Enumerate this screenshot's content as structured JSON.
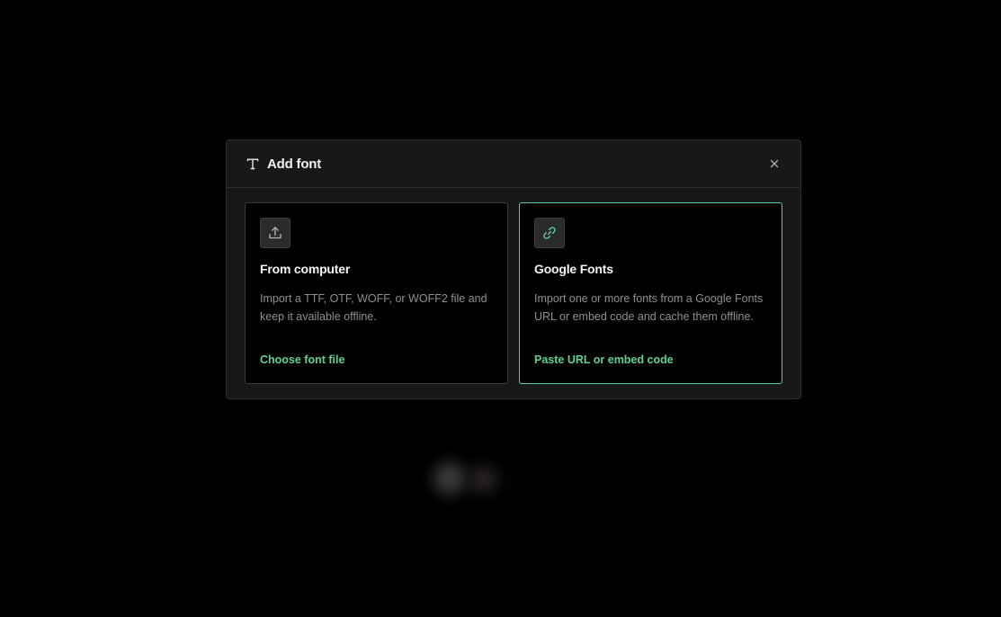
{
  "modal": {
    "title": "Add font",
    "title_icon": "text-t-icon",
    "close_icon": "close-icon"
  },
  "options": [
    {
      "id": "from-computer",
      "icon": "upload-icon",
      "title": "From computer",
      "description": "Import a TTF, OTF, WOFF, or WOFF2 file and keep it available offline.",
      "action_label": "Choose font file",
      "selected": false
    },
    {
      "id": "google-fonts",
      "icon": "link-icon",
      "title": "Google Fonts",
      "description": "Import one or more fonts from a Google Fonts URL or embed code and cache them offline.",
      "action_label": "Paste URL or embed code",
      "selected": true
    }
  ],
  "colors": {
    "accent": "#5fcf96",
    "background": "#000000",
    "modal_bg": "#17181a",
    "border": "#2b2d30"
  }
}
